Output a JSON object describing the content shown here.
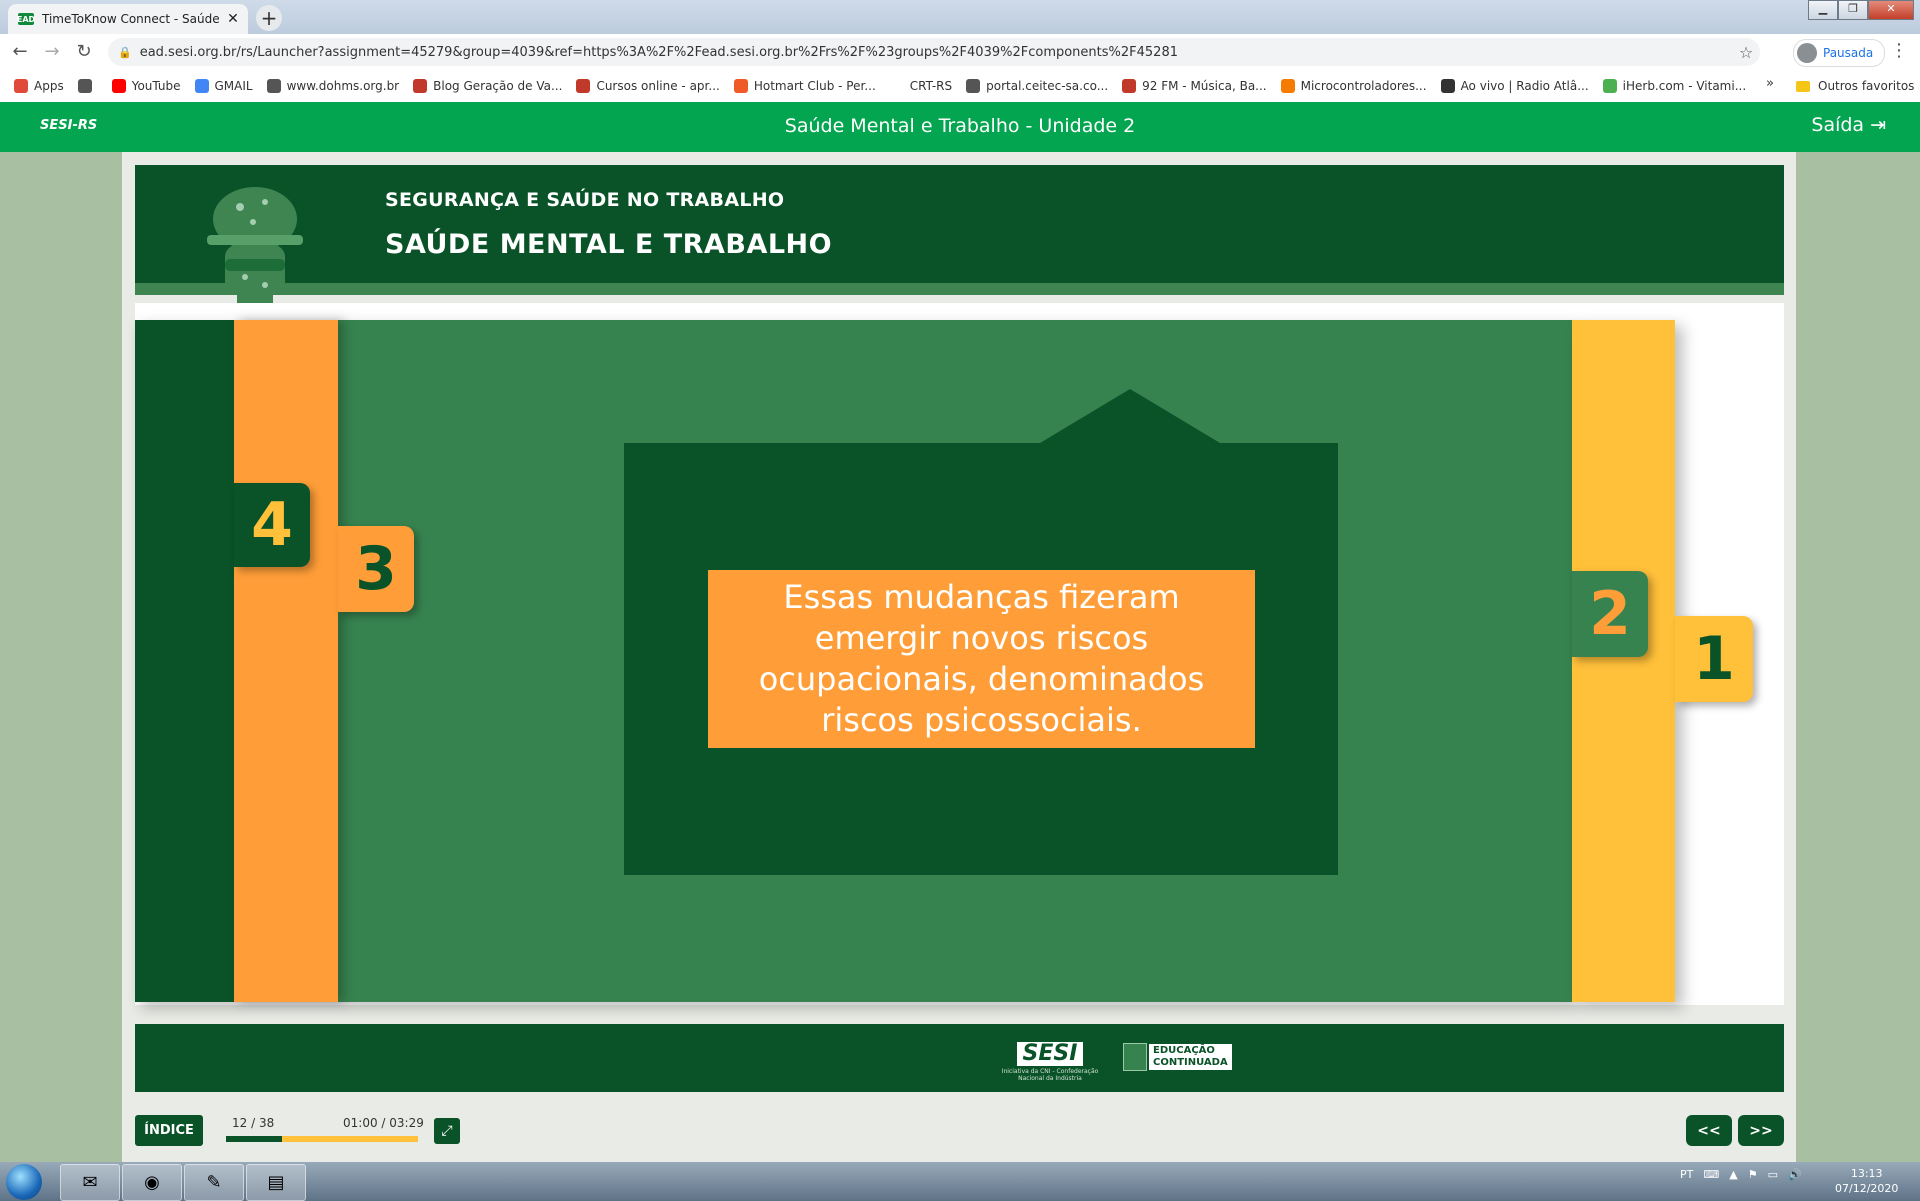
{
  "browser": {
    "tab_title": "TimeToKnow Connect - Saúde M",
    "tab_favicon_text": "EAD",
    "tab_close": "✕",
    "new_tab": "+",
    "url": "ead.sesi.org.br/rs/Launcher?assignment=45279&group=4039&ref=https%3A%2F%2Fead.sesi.org.br%2Frs%2F%23groups%2F4039%2Fcomponents%2F45281",
    "profile_label": "Pausada",
    "bookmarks": [
      {
        "label": "Apps",
        "color": "#e04a3a"
      },
      {
        "label": "",
        "color": "#555555"
      },
      {
        "label": "YouTube",
        "color": "#ff0000"
      },
      {
        "label": "GMAIL",
        "color": "#4285f4"
      },
      {
        "label": "www.dohms.org.br",
        "color": "#555555"
      },
      {
        "label": "Blog Geração de Va...",
        "color": "#c0392b"
      },
      {
        "label": "Cursos online - apr...",
        "color": "#c0392b"
      },
      {
        "label": "Hotmart Club - Per...",
        "color": "#f05a28"
      },
      {
        "label": "CRT-RS",
        "color": "#ffffff"
      },
      {
        "label": "portal.ceitec-sa.co...",
        "color": "#555555"
      },
      {
        "label": "92 FM - Música, Ba...",
        "color": "#c0392b"
      },
      {
        "label": "Microcontroladores...",
        "color": "#f57c00"
      },
      {
        "label": "Ao vivo | Radio Atlâ...",
        "color": "#333333"
      },
      {
        "label": "iHerb.com - Vitami...",
        "color": "#4caf50"
      }
    ],
    "bookmarks_more": "»",
    "other_bookmarks": "Outros favoritos"
  },
  "app": {
    "brand": "SESI-RS",
    "title": "Saúde Mental e Trabalho - Unidade 2",
    "exit_label": "Saída"
  },
  "course": {
    "subtitle": "SEGURANÇA E SAÚDE NO TRABALHO",
    "title": "SAÚDE MENTAL E TRABALHO"
  },
  "slide": {
    "tabs": [
      "4",
      "3",
      "2",
      "1"
    ],
    "message": "Essas mudanças fizeram emergir novos riscos ocupacionais, denominados riscos psicossociais."
  },
  "footer": {
    "sesi_word": "SESI",
    "sesi_tag": "Iniciativa da CNI - Confederação Nacional da Indústria",
    "edu_line1": "EDUCAÇÃO",
    "edu_line2": "CONTINUADA"
  },
  "controls": {
    "index_label": "ÍNDICE",
    "pages": "12 / 38",
    "time": "01:00 / 03:29",
    "progress": 0.29,
    "prev_label": "<<",
    "next_label": ">>"
  },
  "taskbar": {
    "language": "PT",
    "time": "13:13",
    "date": "07/12/2020"
  }
}
